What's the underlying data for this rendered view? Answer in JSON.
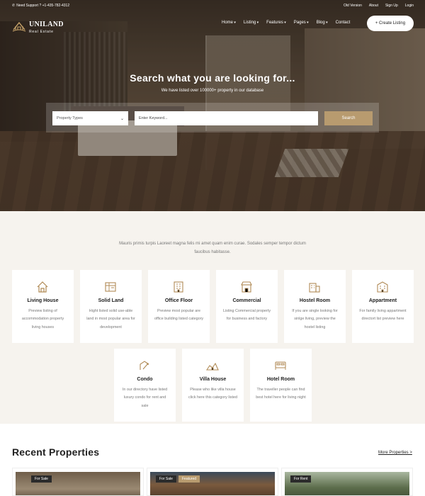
{
  "topbar": {
    "support": "Need Support ? +1-435-782-4312",
    "links": [
      "Old Version",
      "About",
      "Sign Up",
      "Login"
    ]
  },
  "brand": {
    "name": "UNILAND",
    "tagline": "Real Estate"
  },
  "menu": [
    {
      "label": "Home",
      "dropdown": true
    },
    {
      "label": "Listing",
      "dropdown": true
    },
    {
      "label": "Features",
      "dropdown": true
    },
    {
      "label": "Pages",
      "dropdown": true
    },
    {
      "label": "Blog",
      "dropdown": true
    },
    {
      "label": "Contact",
      "dropdown": false
    }
  ],
  "create_listing": "+ Create Listing",
  "hero": {
    "title": "Search what you are looking for...",
    "subtitle": "We have listed over 100000+ property in our database",
    "property_type": "Property Types",
    "keyword_placeholder": "Enter Keyword...",
    "search_label": "Search"
  },
  "categories": {
    "intro": "Mauris primis turpis Laoreet magna felis mi amet quam enim curae. Sodales semper tempor dictum faucibus habitasse.",
    "items": [
      {
        "title": "Living House",
        "desc": "Preview listing of accommodation property living houses",
        "icon": "house-icon"
      },
      {
        "title": "Solid Land",
        "desc": "Hight listed solid use-able land in most popular area for development",
        "icon": "land-map-icon"
      },
      {
        "title": "Office Floor",
        "desc": "Preview most popular are office building listed category",
        "icon": "office-building-icon"
      },
      {
        "title": "Commercial",
        "desc": "Listing Commercial property for business and factory",
        "icon": "storefront-icon"
      },
      {
        "title": "Hostel Room",
        "desc": "If you are single looking for sinlge living, preview the hostel listing",
        "icon": "hostel-icon"
      },
      {
        "title": "Appartment",
        "desc": "For family living appartment directort list preview here",
        "icon": "apartment-icon"
      },
      {
        "title": "Condo",
        "desc": "In our directory have listed luxury condo for rent and sale",
        "icon": "condo-icon"
      },
      {
        "title": "Villa House",
        "desc": "Please who like villa house click here this category listed",
        "icon": "villa-icon"
      },
      {
        "title": "Hotel Room",
        "desc": "The traveller people can find best hotel here for living night",
        "icon": "bed-icon"
      }
    ]
  },
  "recent": {
    "title": "Recent Properties",
    "more": "More Properties >",
    "cards": [
      {
        "badges": [
          "For Sale"
        ]
      },
      {
        "badges": [
          "For Sale",
          "Featured"
        ]
      },
      {
        "badges": [
          "For Rent"
        ]
      }
    ]
  },
  "colors": {
    "accent": "#b89b6f",
    "badge_dark": "#2b2b2b",
    "cream": "#f6f3ee"
  }
}
